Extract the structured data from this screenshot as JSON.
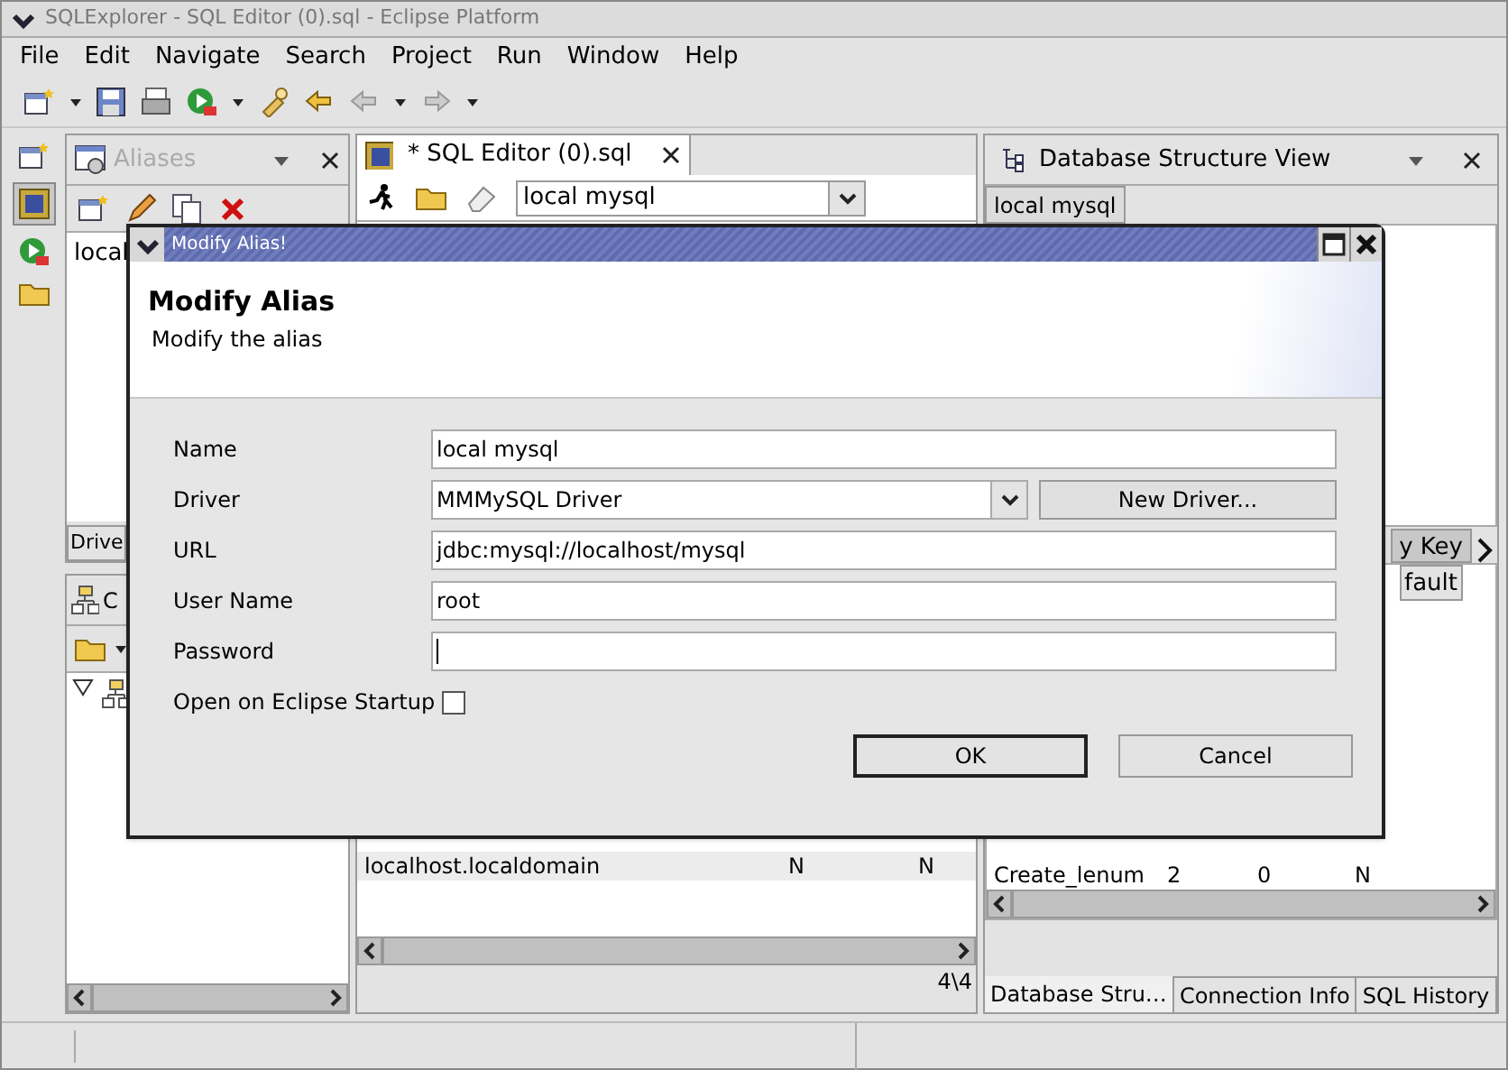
{
  "window": {
    "title": "SQLExplorer - SQL Editor (0).sql - Eclipse Platform"
  },
  "menu": [
    {
      "label": "File"
    },
    {
      "label": "Edit"
    },
    {
      "label": "Navigate"
    },
    {
      "label": "Search"
    },
    {
      "label": "Project"
    },
    {
      "label": "Run"
    },
    {
      "label": "Window"
    },
    {
      "label": "Help"
    }
  ],
  "aliases_view": {
    "title": "Aliases",
    "items": [
      "local"
    ],
    "bottom_tab": "Drive"
  },
  "connections_view": {
    "title": "C"
  },
  "editor": {
    "tab": "* SQL Editor (0).sql",
    "connection": "local mysql",
    "rows": [
      {
        "cells": [
          "localhost.localdomain",
          "N",
          "N"
        ]
      }
    ],
    "row_count": "4\\4"
  },
  "structure_view": {
    "title": "Database Structure View",
    "tab": "local mysql",
    "detail_tab": "y Key",
    "column_header": "fault",
    "rows": [
      {
        "cells": [
          "Create_lenum",
          "2",
          "0",
          "N"
        ]
      }
    ],
    "bottom_tabs": [
      {
        "label": "Database Stru…",
        "selected": true
      },
      {
        "label": "Connection Info",
        "selected": false
      },
      {
        "label": "SQL History",
        "selected": false
      }
    ]
  },
  "dialog": {
    "title": "Modify Alias!",
    "heading": "Modify Alias",
    "subheading": "Modify the alias",
    "fields": [
      {
        "label": "Name",
        "kind": "text",
        "value": "local mysql"
      },
      {
        "label": "Driver",
        "kind": "select",
        "value": "MMMySQL Driver",
        "button": "New Driver..."
      },
      {
        "label": "URL",
        "kind": "text",
        "value": "jdbc:mysql://localhost/mysql"
      },
      {
        "label": "User Name",
        "kind": "text",
        "value": "root"
      },
      {
        "label": "Password",
        "kind": "password",
        "focused": true
      },
      {
        "label": "Open on Eclipse Startup",
        "kind": "checkbox",
        "checked": false
      }
    ],
    "buttons": [
      {
        "label": "OK",
        "default": true
      },
      {
        "label": "Cancel",
        "default": false
      }
    ]
  }
}
